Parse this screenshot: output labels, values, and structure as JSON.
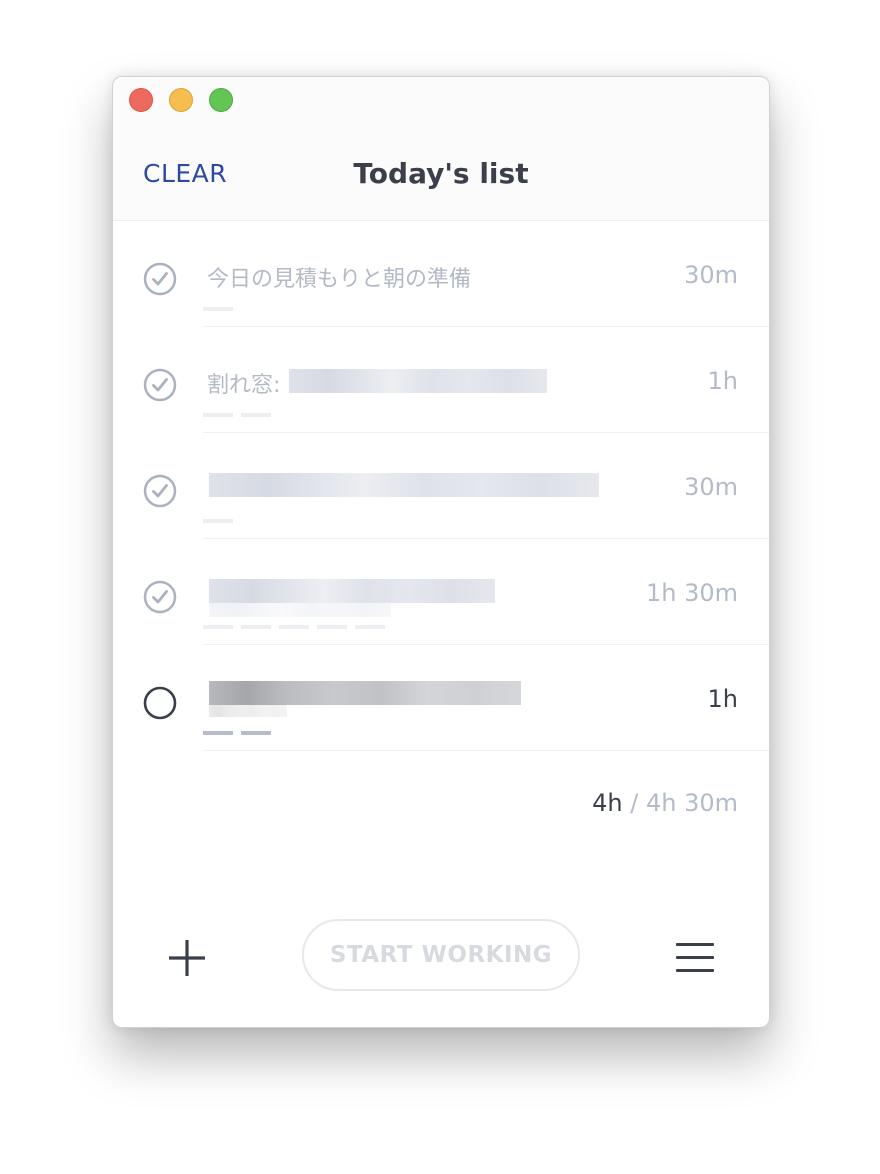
{
  "header": {
    "clear_label": "CLEAR",
    "title": "Today's list"
  },
  "tasks": [
    {
      "title": "今日の見積もりと朝の準備",
      "duration": "30m",
      "done": true,
      "pomodoros": 1
    },
    {
      "title": "割れ窓:",
      "duration": "1h",
      "done": true,
      "pomodoros": 2
    },
    {
      "title": "",
      "duration": "30m",
      "done": true,
      "pomodoros": 1
    },
    {
      "title": "",
      "duration": "1h 30m",
      "done": true,
      "pomodoros": 5
    },
    {
      "title": "",
      "duration": "1h",
      "done": false,
      "pomodoros": 2
    }
  ],
  "total": {
    "done": "4h",
    "separator": "/",
    "all": "4h 30m"
  },
  "footer": {
    "start_label": "START WORKING"
  },
  "colors": {
    "accent": "#2d4aa0",
    "text_dark": "#3a3f4a",
    "text_muted": "#b4bbc8"
  }
}
